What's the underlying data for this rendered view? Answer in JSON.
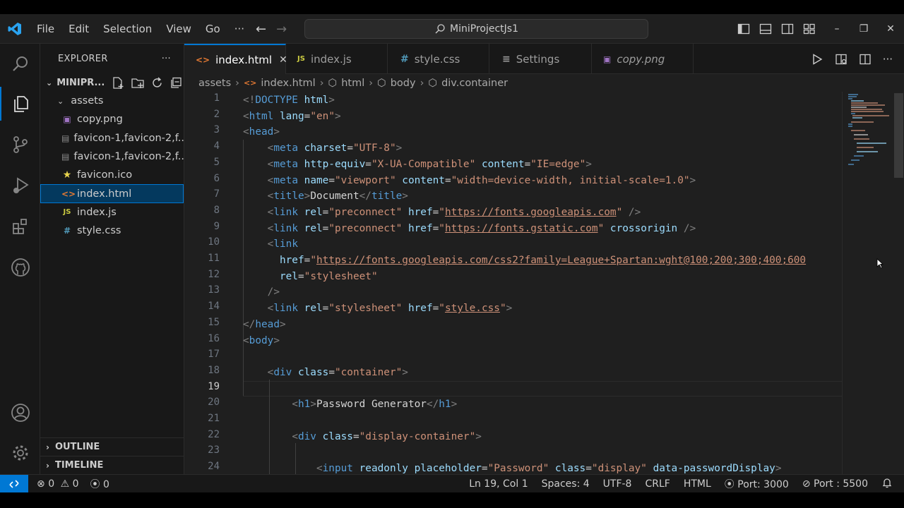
{
  "titlebar": {
    "menu": [
      "File",
      "Edit",
      "Selection",
      "View",
      "Go",
      "···"
    ],
    "search": "MiniProjectJs1"
  },
  "activity": [
    "search-icon",
    "explorer-icon",
    "source-control-icon",
    "run-debug-icon",
    "extensions-icon",
    "github-icon",
    "account-icon",
    "settings-gear-icon"
  ],
  "sidebar": {
    "title": "EXPLORER",
    "more": "···",
    "project": "MINIPR...",
    "items": [
      {
        "label": "assets",
        "type": "folder"
      },
      {
        "label": "copy.png",
        "type": "image"
      },
      {
        "label": "favicon-1,favicon-2,f...",
        "type": "generic"
      },
      {
        "label": "favicon-1,favicon-2,f...",
        "type": "generic"
      },
      {
        "label": "favicon.ico",
        "type": "star"
      },
      {
        "label": "index.html",
        "type": "html"
      },
      {
        "label": "index.js",
        "type": "js"
      },
      {
        "label": "style.css",
        "type": "css"
      }
    ],
    "outline": "OUTLINE",
    "timeline": "TIMELINE"
  },
  "tabs": [
    {
      "label": "index.html",
      "icon": "<>",
      "active": true
    },
    {
      "label": "index.js",
      "icon": "JS"
    },
    {
      "label": "style.css",
      "icon": "#"
    },
    {
      "label": "Settings",
      "icon": "≡"
    },
    {
      "label": "copy.png",
      "icon": "▣"
    }
  ],
  "close_tab": "✕",
  "breadcrumb": [
    "assets",
    "index.html",
    "html",
    "body",
    "div.container"
  ],
  "editor": {
    "current_line": 19,
    "lines": [
      [
        [
          "p",
          "<!"
        ],
        [
          "t",
          "DOCTYPE "
        ],
        [
          "a",
          "html"
        ],
        [
          "p",
          ">"
        ]
      ],
      [
        [
          "p",
          "<"
        ],
        [
          "t",
          "html "
        ],
        [
          "a",
          "lang"
        ],
        [
          "w",
          "="
        ],
        [
          "s",
          "\"en\""
        ],
        [
          "p",
          ">"
        ]
      ],
      [
        [
          "p",
          "<"
        ],
        [
          "t",
          "head"
        ],
        [
          "p",
          ">"
        ]
      ],
      [
        [
          "w",
          "    "
        ],
        [
          "p",
          "<"
        ],
        [
          "t",
          "meta "
        ],
        [
          "a",
          "charset"
        ],
        [
          "w",
          "="
        ],
        [
          "s",
          "\"UTF-8\""
        ],
        [
          "p",
          ">"
        ]
      ],
      [
        [
          "w",
          "    "
        ],
        [
          "p",
          "<"
        ],
        [
          "t",
          "meta "
        ],
        [
          "a",
          "http-equiv"
        ],
        [
          "w",
          "="
        ],
        [
          "s",
          "\"X-UA-Compatible\""
        ],
        [
          "w",
          " "
        ],
        [
          "a",
          "content"
        ],
        [
          "w",
          "="
        ],
        [
          "s",
          "\"IE=edge\""
        ],
        [
          "p",
          ">"
        ]
      ],
      [
        [
          "w",
          "    "
        ],
        [
          "p",
          "<"
        ],
        [
          "t",
          "meta "
        ],
        [
          "a",
          "name"
        ],
        [
          "w",
          "="
        ],
        [
          "s",
          "\"viewport\""
        ],
        [
          "w",
          " "
        ],
        [
          "a",
          "content"
        ],
        [
          "w",
          "="
        ],
        [
          "s",
          "\"width=device-width, initial-scale=1.0\""
        ],
        [
          "p",
          ">"
        ]
      ],
      [
        [
          "w",
          "    "
        ],
        [
          "p",
          "<"
        ],
        [
          "t",
          "title"
        ],
        [
          "p",
          ">"
        ],
        [
          "w",
          "Document"
        ],
        [
          "p",
          "</"
        ],
        [
          "t",
          "title"
        ],
        [
          "p",
          ">"
        ]
      ],
      [
        [
          "w",
          "    "
        ],
        [
          "p",
          "<"
        ],
        [
          "t",
          "link "
        ],
        [
          "a",
          "rel"
        ],
        [
          "w",
          "="
        ],
        [
          "s",
          "\"preconnect\""
        ],
        [
          "w",
          " "
        ],
        [
          "a",
          "href"
        ],
        [
          "w",
          "="
        ],
        [
          "s",
          "\""
        ],
        [
          "u",
          "https://fonts.googleapis.com"
        ],
        [
          "s",
          "\""
        ],
        [
          "w",
          " "
        ],
        [
          "p",
          "/>"
        ]
      ],
      [
        [
          "w",
          "    "
        ],
        [
          "p",
          "<"
        ],
        [
          "t",
          "link "
        ],
        [
          "a",
          "rel"
        ],
        [
          "w",
          "="
        ],
        [
          "s",
          "\"preconnect\""
        ],
        [
          "w",
          " "
        ],
        [
          "a",
          "href"
        ],
        [
          "w",
          "="
        ],
        [
          "s",
          "\""
        ],
        [
          "u",
          "https://fonts.gstatic.com"
        ],
        [
          "s",
          "\""
        ],
        [
          "w",
          " "
        ],
        [
          "a",
          "crossorigin"
        ],
        [
          "w",
          " "
        ],
        [
          "p",
          "/>"
        ]
      ],
      [
        [
          "w",
          "    "
        ],
        [
          "p",
          "<"
        ],
        [
          "t",
          "link"
        ]
      ],
      [
        [
          "w",
          "      "
        ],
        [
          "a",
          "href"
        ],
        [
          "w",
          "="
        ],
        [
          "s",
          "\""
        ],
        [
          "u",
          "https://fonts.googleapis.com/css2?family=League+Spartan:wght@100;200;300;400;600"
        ]
      ],
      [
        [
          "w",
          "      "
        ],
        [
          "a",
          "rel"
        ],
        [
          "w",
          "="
        ],
        [
          "s",
          "\"stylesheet\""
        ]
      ],
      [
        [
          "w",
          "    "
        ],
        [
          "p",
          "/>"
        ]
      ],
      [
        [
          "w",
          "    "
        ],
        [
          "p",
          "<"
        ],
        [
          "t",
          "link "
        ],
        [
          "a",
          "rel"
        ],
        [
          "w",
          "="
        ],
        [
          "s",
          "\"stylesheet\""
        ],
        [
          "w",
          " "
        ],
        [
          "a",
          "href"
        ],
        [
          "w",
          "="
        ],
        [
          "s",
          "\""
        ],
        [
          "u",
          "style.css"
        ],
        [
          "s",
          "\""
        ],
        [
          "p",
          ">"
        ]
      ],
      [
        [
          "p",
          "</"
        ],
        [
          "t",
          "head"
        ],
        [
          "p",
          ">"
        ]
      ],
      [
        [
          "p",
          "<"
        ],
        [
          "t",
          "body"
        ],
        [
          "p",
          ">"
        ]
      ],
      [],
      [
        [
          "w",
          "    "
        ],
        [
          "p",
          "<"
        ],
        [
          "t",
          "div "
        ],
        [
          "a",
          "class"
        ],
        [
          "w",
          "="
        ],
        [
          "s",
          "\"container\""
        ],
        [
          "p",
          ">"
        ]
      ],
      [],
      [
        [
          "w",
          "        "
        ],
        [
          "p",
          "<"
        ],
        [
          "t",
          "h1"
        ],
        [
          "p",
          ">"
        ],
        [
          "w",
          "Password Generator"
        ],
        [
          "p",
          "</"
        ],
        [
          "t",
          "h1"
        ],
        [
          "p",
          ">"
        ]
      ],
      [],
      [
        [
          "w",
          "        "
        ],
        [
          "p",
          "<"
        ],
        [
          "t",
          "div "
        ],
        [
          "a",
          "class"
        ],
        [
          "w",
          "="
        ],
        [
          "s",
          "\"display-container\""
        ],
        [
          "p",
          ">"
        ]
      ],
      [],
      [
        [
          "w",
          "            "
        ],
        [
          "p",
          "<"
        ],
        [
          "t",
          "input "
        ],
        [
          "a",
          "readonly"
        ],
        [
          "w",
          " "
        ],
        [
          "a",
          "placeholder"
        ],
        [
          "w",
          "="
        ],
        [
          "s",
          "\"Password\""
        ],
        [
          "w",
          " "
        ],
        [
          "a",
          "class"
        ],
        [
          "w",
          "="
        ],
        [
          "s",
          "\"display\""
        ],
        [
          "w",
          " "
        ],
        [
          "a",
          "data-passwordDisplay"
        ],
        [
          "p",
          ">"
        ]
      ]
    ]
  },
  "status": {
    "errors": "0",
    "warnings": "0",
    "ports_count": "0",
    "position": "Ln 19, Col 1",
    "spaces": "Spaces: 4",
    "encoding": "UTF-8",
    "eol": "CRLF",
    "language": "HTML",
    "port1": "Port: 3000",
    "port2": "Port : 5500"
  },
  "colors": {
    "accent": "#0078d4",
    "tag": "#569cd6",
    "attr": "#9cdcfe",
    "string": "#ce9178"
  }
}
